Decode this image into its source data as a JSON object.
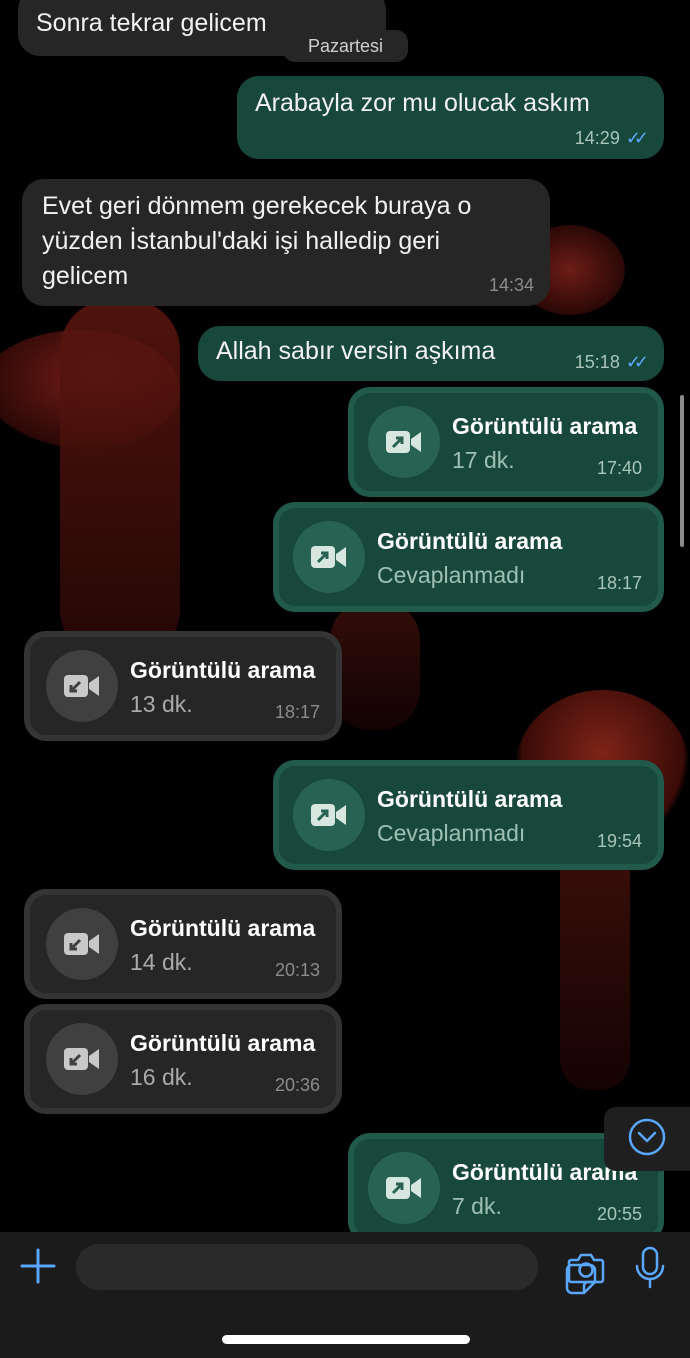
{
  "chat": {
    "day_separator": "Pazartesi",
    "messages": [
      {
        "text": "Sonra tekrar gelicem"
      },
      {
        "text": "Arabayla zor mu olucak askım",
        "time": "14:29",
        "read": "✓✓"
      },
      {
        "text": "Evet geri dönmem gerekecek buraya o yüzden İstanbul'daki işi halledip geri gelicem",
        "lines": [
          "Evet geri dönmem gerekecek buraya o",
          "yüzden İstanbul'daki işi halledip geri",
          "gelicem"
        ],
        "time": "14:34"
      },
      {
        "text": "Allah sabır versin aşkıma",
        "time": "15:18",
        "read": "✓✓"
      }
    ],
    "calls": [
      {
        "title": "Görüntülü arama",
        "sub": "17 dk.",
        "time": "17:40"
      },
      {
        "title": "Görüntülü arama",
        "sub": "Cevaplanmadı",
        "time": "18:17"
      },
      {
        "title": "Görüntülü arama",
        "sub": "13 dk.",
        "time": "18:17"
      },
      {
        "title": "Görüntülü arama",
        "sub": "Cevaplanmadı",
        "time": "19:54"
      },
      {
        "title": "Görüntülü arama",
        "sub": "14 dk.",
        "time": "20:13"
      },
      {
        "title": "Görüntülü arama",
        "sub": "16 dk.",
        "time": "20:36"
      },
      {
        "title": "Görüntülü arama",
        "sub": "7 dk.",
        "time": "20:55"
      }
    ]
  },
  "composer": {
    "placeholder": ""
  },
  "icons": {
    "add": "plus-icon",
    "sticker": "sticker-icon",
    "camera": "camera-icon",
    "mic": "microphone-icon",
    "scroll": "chevron-down-icon",
    "outgoing_call": "outgoing-video-call-icon",
    "incoming_call": "incoming-video-call-icon"
  },
  "colors": {
    "accent": "#5aa7ff",
    "outgoing_bubble": "#18483b",
    "incoming_bubble": "#262626"
  }
}
